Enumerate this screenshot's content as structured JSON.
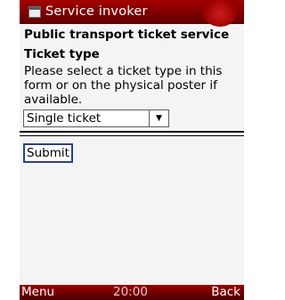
{
  "titlebar": {
    "title": "Service invoker"
  },
  "content": {
    "heading": "Public transport ticket service",
    "subheading": "Ticket type",
    "description": "Please select a ticket type in this form or on the physical poster if available.",
    "ticket_select": {
      "value": "Single ticket"
    },
    "submit_label": "Submit"
  },
  "softkeys": {
    "left": "Menu",
    "time": "20:00",
    "right": "Back"
  }
}
